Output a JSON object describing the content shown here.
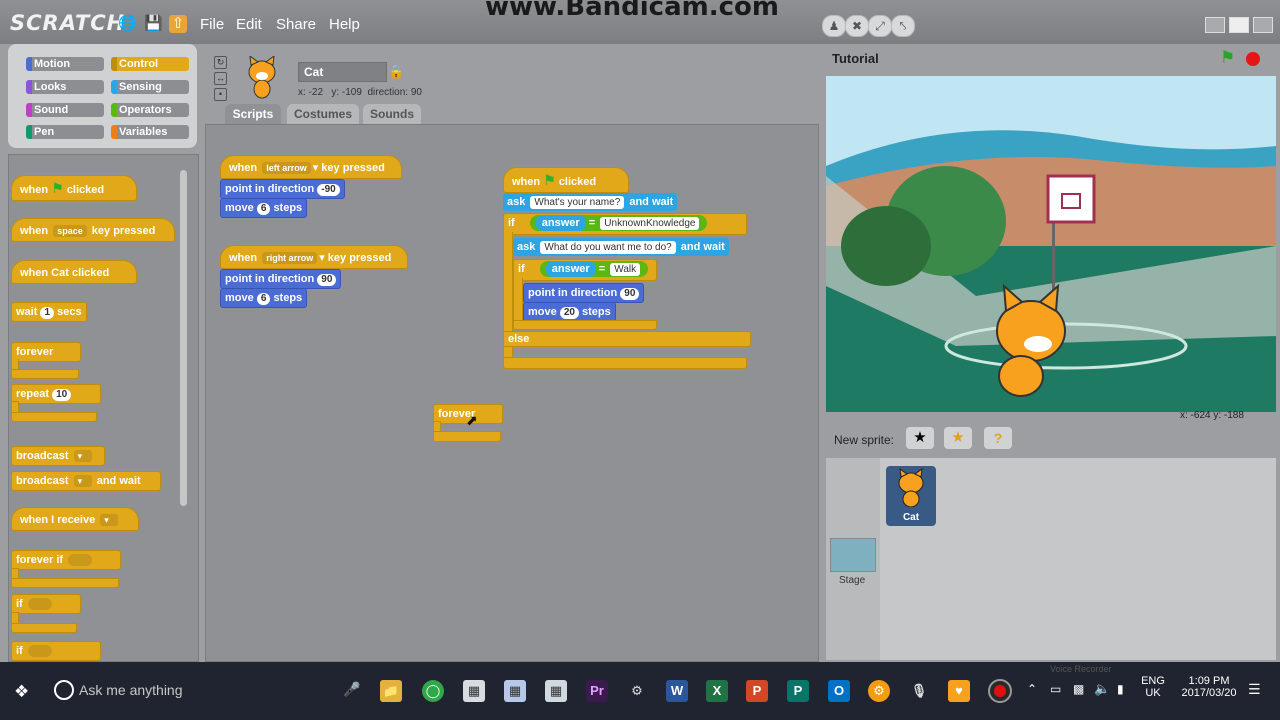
{
  "app": {
    "logo": "SCRATCH",
    "watermark": "www.Bandicam.com",
    "menu": [
      "File",
      "Edit",
      "Share",
      "Help"
    ]
  },
  "categories": [
    {
      "label": "Motion",
      "color": "#4a6cd4"
    },
    {
      "label": "Control",
      "color": "#e1a91a"
    },
    {
      "label": "Looks",
      "color": "#8a55d7"
    },
    {
      "label": "Sensing",
      "color": "#2ca5e2"
    },
    {
      "label": "Sound",
      "color": "#bb42c3"
    },
    {
      "label": "Operators",
      "color": "#5cb712"
    },
    {
      "label": "Pen",
      "color": "#0e9a6c"
    },
    {
      "label": "Variables",
      "color": "#ee7d16"
    }
  ],
  "palette": {
    "when_flag": [
      "when",
      "clicked"
    ],
    "when_key": [
      "when",
      "space",
      "key pressed"
    ],
    "when_sprite": "when Cat clicked",
    "wait": [
      "wait",
      "1",
      "secs"
    ],
    "forever": "forever",
    "repeat": [
      "repeat",
      "10"
    ],
    "broadcast": "broadcast",
    "broadcast_wait": [
      "broadcast",
      "and wait"
    ],
    "when_receive": "when I receive",
    "forever_if": "forever if",
    "if1": "if",
    "if2": "if"
  },
  "sprite": {
    "name": "Cat",
    "x_label": "x: -22",
    "y_label": "y: -109",
    "direction_label": "direction: 90"
  },
  "tabs": [
    "Scripts",
    "Costumes",
    "Sounds"
  ],
  "scripts": {
    "s1": {
      "hat": [
        "when",
        "left arrow",
        "key pressed"
      ],
      "dir": [
        "point in direction",
        "-90"
      ],
      "move": [
        "move",
        "6",
        "steps"
      ]
    },
    "s2": {
      "hat": [
        "when",
        "right arrow",
        "key pressed"
      ],
      "dir": [
        "point in direction",
        "90"
      ],
      "move": [
        "move",
        "6",
        "steps"
      ]
    },
    "s3": {
      "hat": [
        "when",
        "clicked"
      ],
      "ask1": [
        "ask",
        "What's your name?",
        "and wait"
      ],
      "if1": [
        "if",
        "answer",
        "=",
        "UnknownKnowledge"
      ],
      "ask2": [
        "ask",
        "What do you want me to do?",
        "and wait"
      ],
      "if2": [
        "if",
        "answer",
        "=",
        "Walk"
      ],
      "dir": [
        "point in direction",
        "90"
      ],
      "move": [
        "move",
        "20",
        "steps"
      ],
      "else": "else"
    },
    "loose_forever": "forever"
  },
  "stage": {
    "title": "Tutorial",
    "mouse": "x: -624   y: -188",
    "new_sprite": "New sprite:",
    "sprites": [
      {
        "name": "Cat"
      }
    ],
    "stage_label": "Stage"
  },
  "taskbar": {
    "search": "Ask me anything",
    "lang": "ENG",
    "region": "UK",
    "time": "1:09 PM",
    "date": "2017/03/20",
    "faded_text": "Voice Recorder"
  }
}
